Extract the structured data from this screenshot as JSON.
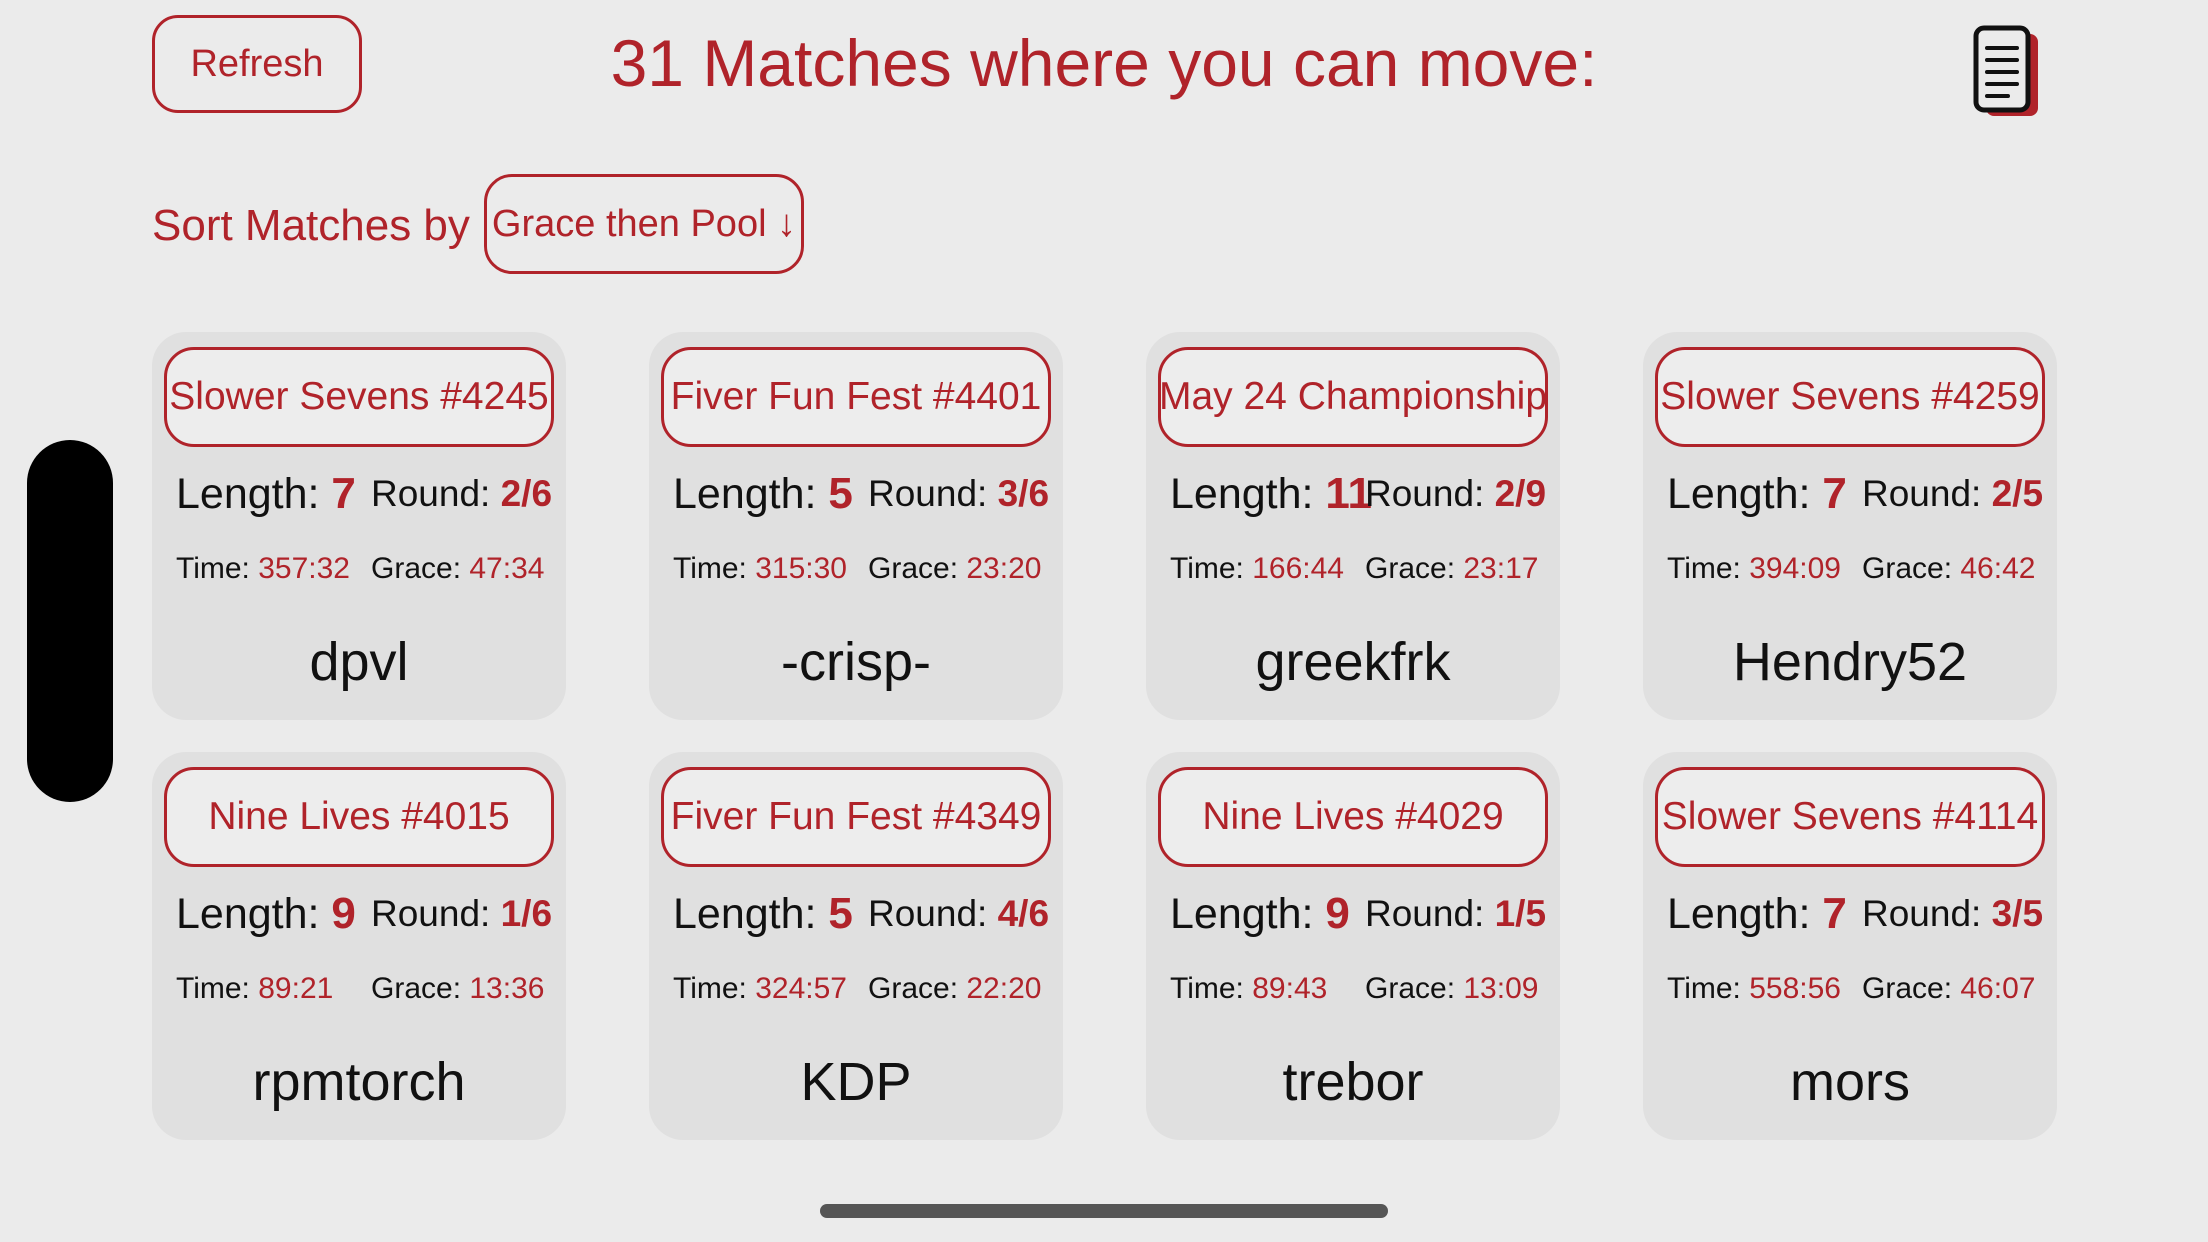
{
  "header": {
    "refresh_label": "Refresh",
    "title": "31 Matches where you can move:",
    "doc_icon": "document-icon"
  },
  "sort": {
    "label": "Sort Matches by",
    "selected": "Grace then Pool ↓"
  },
  "labels": {
    "length": "Length: ",
    "round": "Round: ",
    "time": "Time: ",
    "grace": "Grace: "
  },
  "colors": {
    "accent": "#b0232a",
    "background": "#ebebeb",
    "card": "#e0e0e0"
  },
  "matches": [
    {
      "event": "Slower Sevens #4245",
      "length": "7",
      "round": "2/6",
      "time": "357:32",
      "grace": "47:34",
      "opponent": "dpvl"
    },
    {
      "event": "Fiver Fun Fest #4401",
      "length": "5",
      "round": "3/6",
      "time": "315:30",
      "grace": "23:20",
      "opponent": "-crisp-"
    },
    {
      "event": "May 24 Championship",
      "length": "11",
      "round": "2/9",
      "time": "166:44",
      "grace": "23:17",
      "opponent": "greekfrk"
    },
    {
      "event": "Slower Sevens #4259",
      "length": "7",
      "round": "2/5",
      "time": "394:09",
      "grace": "46:42",
      "opponent": "Hendry52"
    },
    {
      "event": "Nine Lives #4015",
      "length": "9",
      "round": "1/6",
      "time": "89:21",
      "grace": "13:36",
      "opponent": "rpmtorch"
    },
    {
      "event": "Fiver Fun Fest #4349",
      "length": "5",
      "round": "4/6",
      "time": "324:57",
      "grace": "22:20",
      "opponent": "KDP"
    },
    {
      "event": "Nine Lives #4029",
      "length": "9",
      "round": "1/5",
      "time": "89:43",
      "grace": "13:09",
      "opponent": "trebor"
    },
    {
      "event": "Slower Sevens #4114",
      "length": "7",
      "round": "3/5",
      "time": "558:56",
      "grace": "46:07",
      "opponent": "mors"
    }
  ]
}
